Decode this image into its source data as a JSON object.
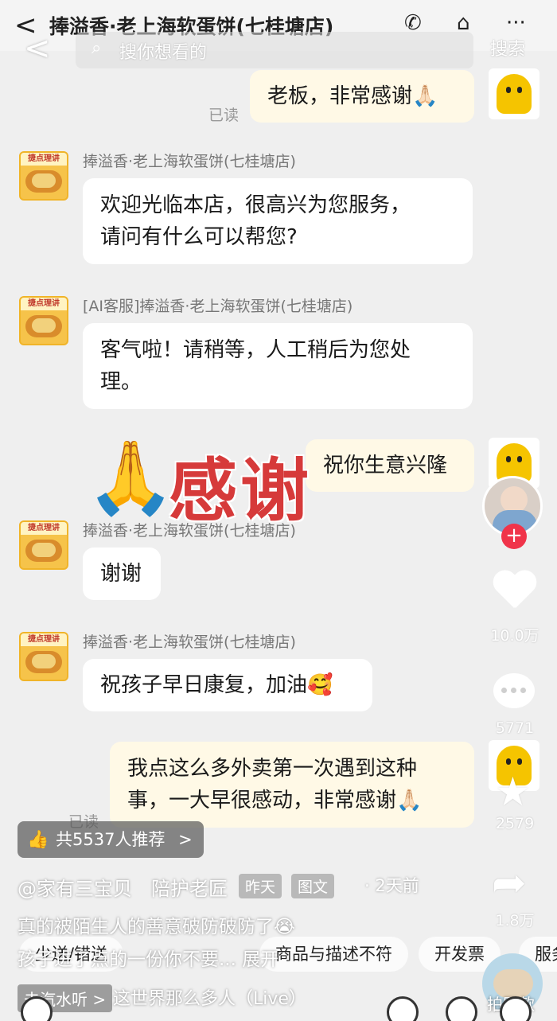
{
  "chat_header": {
    "back": "<",
    "title": "捧溢香·老上海软蛋饼(七桂塘店)",
    "phone_icon": "phone-icon",
    "shop_icon": "shop-icon",
    "more_icon": "more-icon"
  },
  "search": {
    "back": "<",
    "placeholder": "搜你想看的",
    "button": "搜索"
  },
  "messages": {
    "m1": {
      "text": "老板，非常感谢🙏🏻",
      "status": "已读"
    },
    "m2": {
      "sender": "捧溢香·老上海软蛋饼(七桂塘店)",
      "line1": "欢迎光临本店，很高兴为您服务，",
      "line2": "请问有什么可以帮您?"
    },
    "m3": {
      "sender": "[AI客服]捧溢香·老上海软蛋饼(七桂塘店)",
      "line1": "客气啦！请稍等，人工稍后为您处",
      "line2": "理。"
    },
    "m4": {
      "text": "祝你生意兴隆"
    },
    "m5": {
      "sender": "捧溢香·老上海软蛋饼(七桂塘店)",
      "text": "谢谢"
    },
    "m6": {
      "sender": "捧溢香·老上海软蛋饼(七桂塘店)",
      "text": "祝孩子早日康复，加油🥰"
    },
    "m7": {
      "line1": "我点这么多外卖第一次遇到这种",
      "line2": "事，一大早很感动，非常感谢🙏🏻",
      "status": "已读"
    }
  },
  "avatar_label": "捷点理讲",
  "sticker": {
    "emoji": "🙏",
    "text": "感谢"
  },
  "rail": {
    "likes": "10.0万",
    "comments": "5771",
    "favorites": "2579",
    "shares": "1.8万",
    "plus": "+"
  },
  "overlay": {
    "recommend": "共5537人推荐",
    "recommend_chevron": ">",
    "author": "@家有三宝贝　陪护老匠",
    "meta_time": "昨天",
    "meta_type": "图文",
    "date": "· 2天前",
    "caption": "真的被陌生人的善意破防破防了😭",
    "caption2": "孩子进了点的一份你不要... 展开",
    "chips": [
      "少送/错送",
      "商品与描述不符",
      "开发票",
      "服务"
    ],
    "music_tag": "去汽水听 >",
    "music_title": "这世界那么多人（Live）",
    "same_style": "拍同款"
  }
}
